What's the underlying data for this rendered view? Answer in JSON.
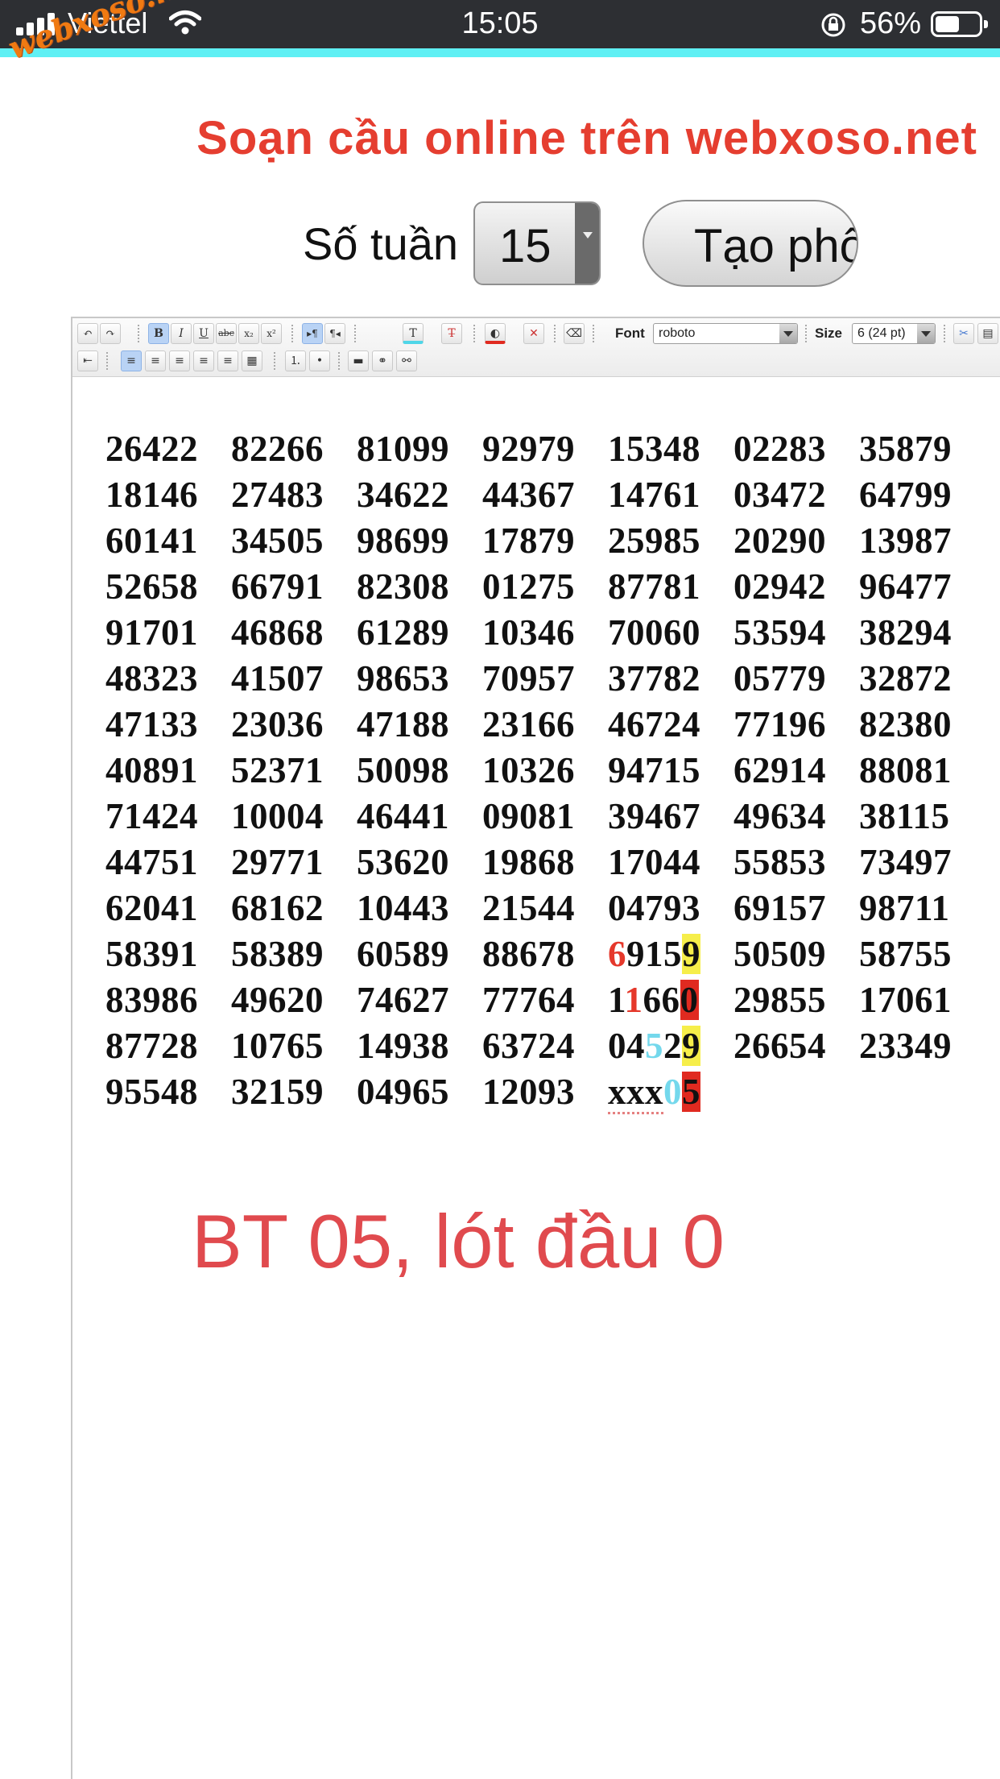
{
  "status_bar": {
    "carrier": "Viettel",
    "time": "15:05",
    "battery_percent": "56%",
    "battery_level": 0.56
  },
  "watermark": "webxoso.net",
  "header": {
    "title": "Soạn cầu online trên webxoso.net",
    "weeks_label": "Số tuần",
    "weeks_value": "15",
    "create_button": "Tạo phôi"
  },
  "toolbar": {
    "font_label": "Font",
    "font_value": "roboto",
    "size_label": "Size",
    "size_value": "6 (24 pt)"
  },
  "grid_rows": [
    [
      "26422",
      "82266",
      "81099",
      "92979",
      "15348",
      "02283",
      "35879"
    ],
    [
      "18146",
      "27483",
      "34622",
      "44367",
      "14761",
      "03472",
      "64799"
    ],
    [
      "60141",
      "34505",
      "98699",
      "17879",
      "25985",
      "20290",
      "13987"
    ],
    [
      "52658",
      "66791",
      "82308",
      "01275",
      "87781",
      "02942",
      "96477"
    ],
    [
      "91701",
      "46868",
      "61289",
      "10346",
      "70060",
      "53594",
      "38294"
    ],
    [
      "48323",
      "41507",
      "98653",
      "70957",
      "37782",
      "05779",
      "32872"
    ],
    [
      "47133",
      "23036",
      "47188",
      "23166",
      "46724",
      "77196",
      "82380"
    ],
    [
      "40891",
      "52371",
      "50098",
      "10326",
      "94715",
      "62914",
      "88081"
    ],
    [
      "71424",
      "10004",
      "46441",
      "09081",
      "39467",
      "49634",
      "38115"
    ],
    [
      "44751",
      "29771",
      "53620",
      "19868",
      "17044",
      "55853",
      "73497"
    ],
    [
      "62041",
      "68162",
      "10443",
      "21544",
      "04793",
      "69157",
      "98711"
    ],
    [
      "58391",
      "58389",
      "60589",
      "88678",
      "69159",
      "50509",
      "58755"
    ],
    [
      "83986",
      "49620",
      "74627",
      "77764",
      "11660",
      "29855",
      "17061"
    ],
    [
      "87728",
      "10765",
      "14938",
      "63724",
      "04529",
      "26654",
      "23349"
    ],
    [
      "95548",
      "32159",
      "04965",
      "12093",
      "xxx05"
    ]
  ],
  "highlight": {
    "r11_a": "6",
    "r11_b": "915",
    "r11_c": "9",
    "r12_a": "1",
    "r12_b": "1",
    "r12_c": "66",
    "r12_d": "0",
    "r13_a": "04",
    "r13_b": "5",
    "r13_c": "2",
    "r13_d": "9",
    "r14_a": "xxx",
    "r14_b": "0",
    "r14_c": "5"
  },
  "note": "BT 05, lót đầu 0",
  "colors": {
    "title": "#e53e30",
    "accent_bar": "#5ff0f4",
    "note": "#e04a4e",
    "highlight_red": "#e5382b",
    "highlight_cyan": "#74d8ec",
    "highlight_yellow_bg": "#f6ee4a",
    "highlight_red_bg": "#e02a20"
  }
}
